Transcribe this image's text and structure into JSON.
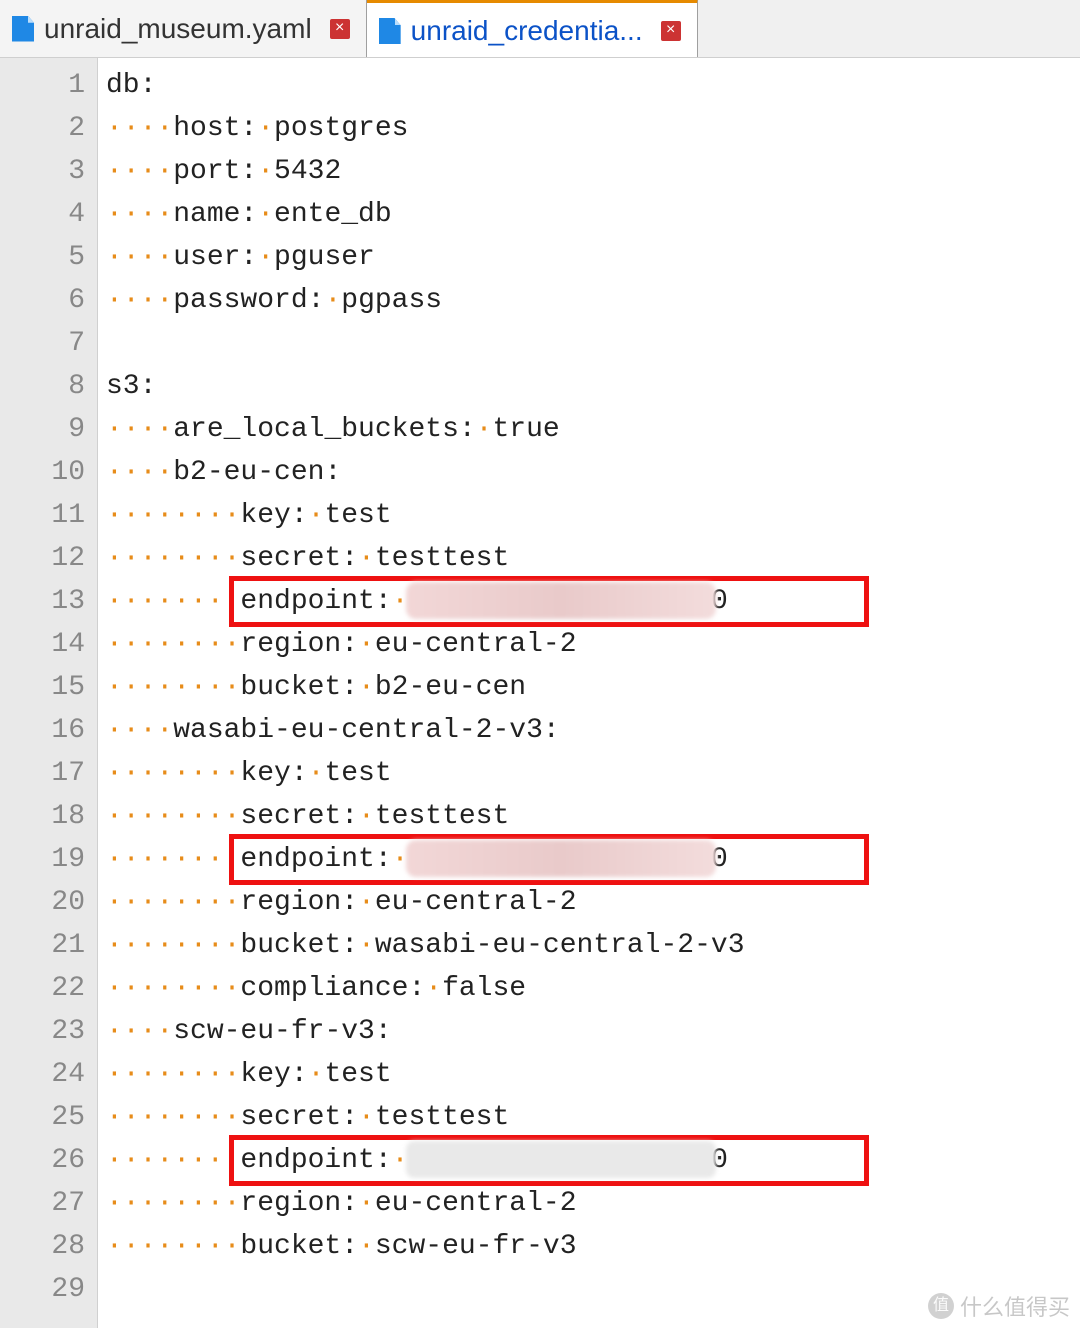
{
  "tabs": [
    {
      "label": "unraid_museum.yaml",
      "active": false
    },
    {
      "label": "unraid_credentia...",
      "active": true
    }
  ],
  "indent_unit": "····",
  "code": {
    "lines": [
      {
        "n": 1,
        "indent": 0,
        "text": "db:"
      },
      {
        "n": 2,
        "indent": 1,
        "text": "host: postgres"
      },
      {
        "n": 3,
        "indent": 1,
        "text": "port: 5432"
      },
      {
        "n": 4,
        "indent": 1,
        "text": "name: ente_db"
      },
      {
        "n": 5,
        "indent": 1,
        "text": "user: pguser"
      },
      {
        "n": 6,
        "indent": 1,
        "text": "password: pgpass"
      },
      {
        "n": 7,
        "indent": 0,
        "text": ""
      },
      {
        "n": 8,
        "indent": 0,
        "text": "s3:"
      },
      {
        "n": 9,
        "indent": 1,
        "text": "are_local_buckets: true"
      },
      {
        "n": 10,
        "indent": 1,
        "text": "b2-eu-cen:"
      },
      {
        "n": 11,
        "indent": 2,
        "text": "key: test"
      },
      {
        "n": 12,
        "indent": 2,
        "text": "secret: testtest"
      },
      {
        "n": 13,
        "indent": 2,
        "text": "endpoint:               :3200",
        "highlight": "pink"
      },
      {
        "n": 14,
        "indent": 2,
        "text": "region: eu-central-2"
      },
      {
        "n": 15,
        "indent": 2,
        "text": "bucket: b2-eu-cen"
      },
      {
        "n": 16,
        "indent": 1,
        "text": "wasabi-eu-central-2-v3:"
      },
      {
        "n": 17,
        "indent": 2,
        "text": "key: test"
      },
      {
        "n": 18,
        "indent": 2,
        "text": "secret: testtest"
      },
      {
        "n": 19,
        "indent": 2,
        "text": "endpoint:               :3200",
        "highlight": "pink"
      },
      {
        "n": 20,
        "indent": 2,
        "text": "region: eu-central-2"
      },
      {
        "n": 21,
        "indent": 2,
        "text": "bucket: wasabi-eu-central-2-v3"
      },
      {
        "n": 22,
        "indent": 2,
        "text": "compliance: false"
      },
      {
        "n": 23,
        "indent": 1,
        "text": "scw-eu-fr-v3:"
      },
      {
        "n": 24,
        "indent": 2,
        "text": "key: test"
      },
      {
        "n": 25,
        "indent": 2,
        "text": "secret: testtest"
      },
      {
        "n": 26,
        "indent": 2,
        "text": "endpoint:                3200",
        "highlight": "grey"
      },
      {
        "n": 27,
        "indent": 2,
        "text": "region: eu-central-2"
      },
      {
        "n": 28,
        "indent": 2,
        "text": "bucket: scw-eu-fr-v3"
      },
      {
        "n": 29,
        "indent": 0,
        "text": ""
      }
    ]
  },
  "watermark": "什么值得买"
}
